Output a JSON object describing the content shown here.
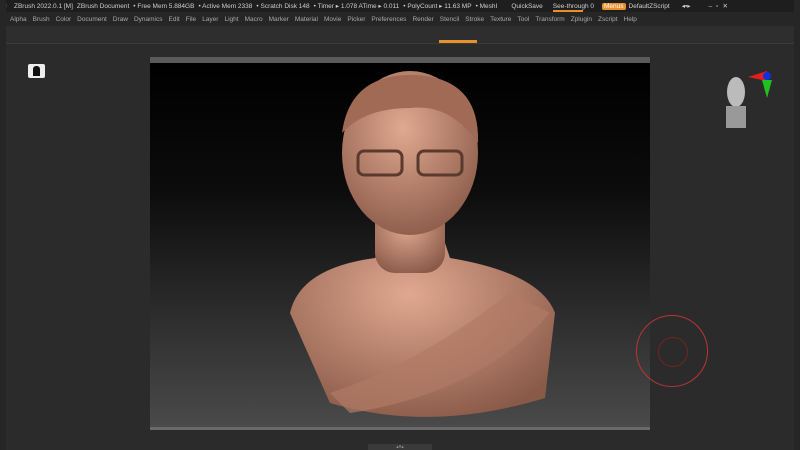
{
  "titlebar": {
    "app": "ZBrush 2022.0.1 [M]",
    "document": "ZBrush Document",
    "free_mem": "• Free Mem 5.884GB",
    "active_mem": "• Active Mem 2338",
    "scratch": "• Scratch Disk 148",
    "timer": "• Timer ▸ 1.078 ATime ▸ 0.011",
    "polycount": "• PolyCount ▸ 11.63 MP",
    "mesh": "• MeshI",
    "quicksave": "QuickSave",
    "see_through": "See-through  0",
    "see_through_value": 0,
    "menus": "Menus",
    "script": "DefaultZScript"
  },
  "menubar": [
    "Alpha",
    "Brush",
    "Color",
    "Document",
    "Draw",
    "Dynamics",
    "Edit",
    "File",
    "Layer",
    "Light",
    "Macro",
    "Marker",
    "Material",
    "Movie",
    "Picker",
    "Preferences",
    "Render",
    "Stencil",
    "Stroke",
    "Texture",
    "Tool",
    "Transform",
    "Zplugin",
    "Zscript",
    "Help"
  ],
  "colors": {
    "accent": "#e8902c",
    "skin": "#c98f78",
    "axis_x": "#e02020",
    "axis_y": "#20c020",
    "axis_z": "#1030e0"
  }
}
